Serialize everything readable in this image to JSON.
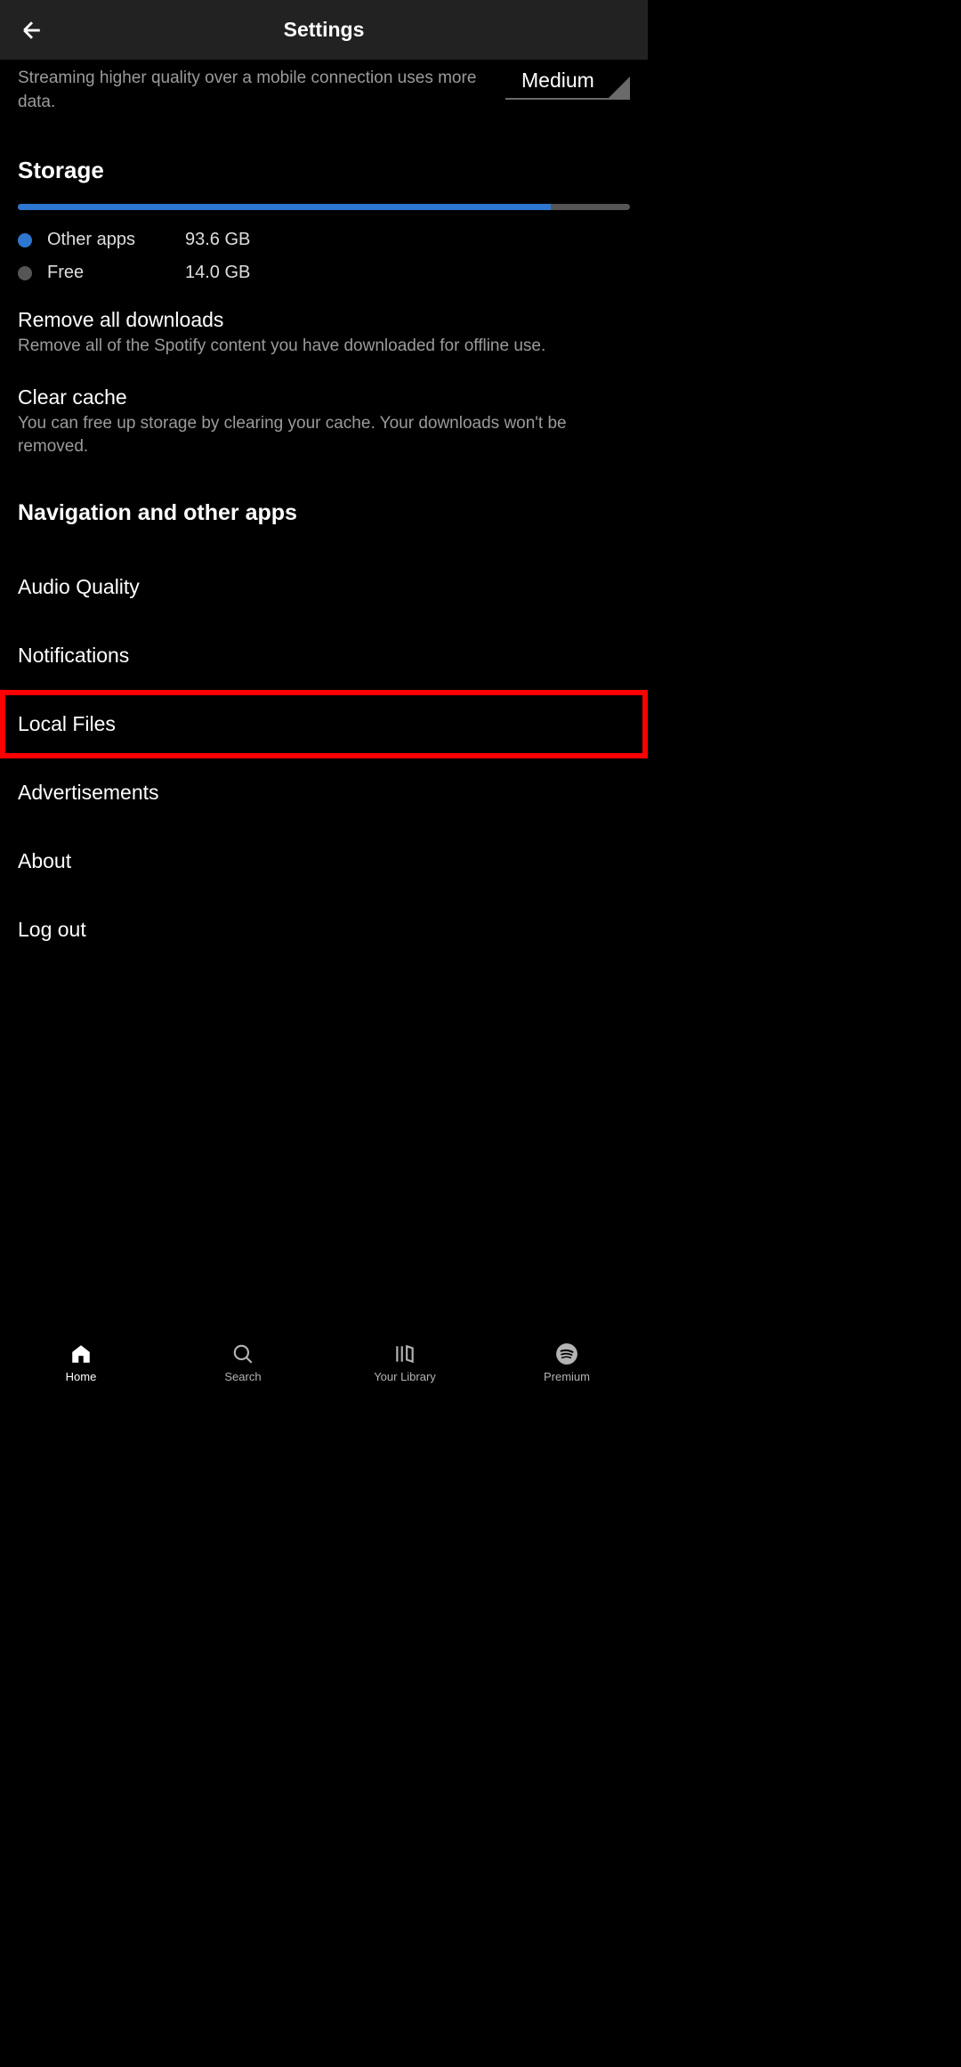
{
  "header": {
    "title": "Settings"
  },
  "quality": {
    "description": "Streaming higher quality over a mobile connection uses more data.",
    "value": "Medium"
  },
  "storage": {
    "heading": "Storage",
    "bar_fill_pct": 87,
    "legend": [
      {
        "color": "#2e77d0",
        "label": "Other apps",
        "value": "93.6 GB"
      },
      {
        "color": "#555555",
        "label": "Free",
        "value": "14.0 GB"
      }
    ]
  },
  "actions": {
    "remove_downloads": {
      "title": "Remove all downloads",
      "desc": "Remove all of the Spotify content you have downloaded for offline use."
    },
    "clear_cache": {
      "title": "Clear cache",
      "desc": "You can free up storage by clearing your cache. Your downloads won't be removed."
    }
  },
  "nav_section": "Navigation and other apps",
  "menu": [
    {
      "label": "Audio Quality",
      "highlighted": false
    },
    {
      "label": "Notifications",
      "highlighted": false
    },
    {
      "label": "Local Files",
      "highlighted": true
    },
    {
      "label": "Advertisements",
      "highlighted": false
    },
    {
      "label": "About",
      "highlighted": false
    },
    {
      "label": "Log out",
      "highlighted": false
    }
  ],
  "bottom_nav": {
    "home": "Home",
    "search": "Search",
    "library": "Your Library",
    "premium": "Premium"
  }
}
